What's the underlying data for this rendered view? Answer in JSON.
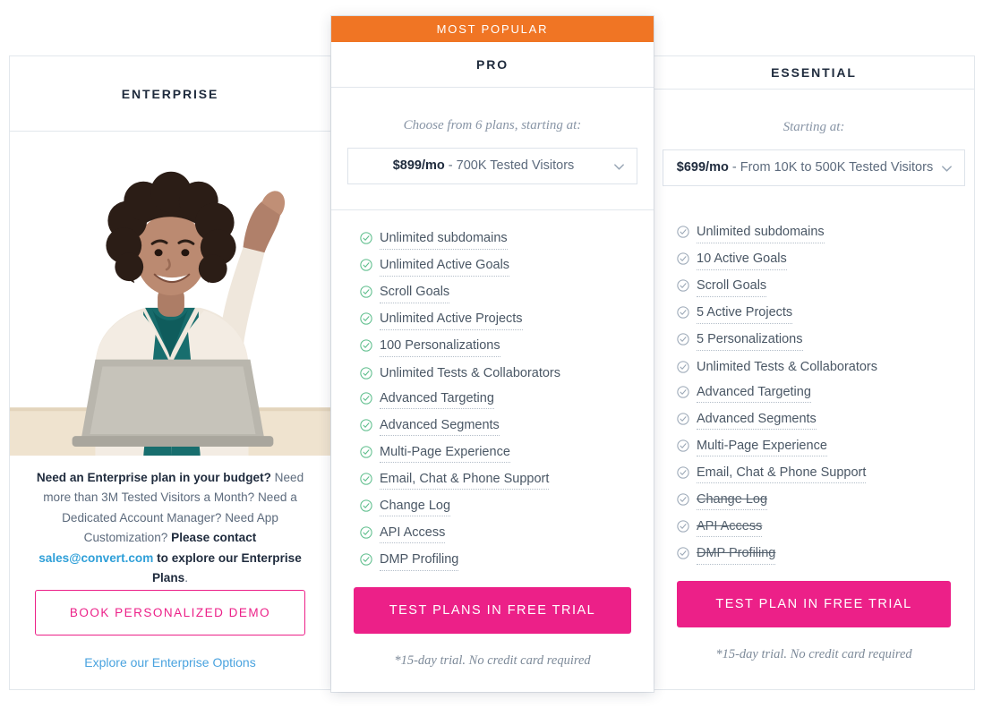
{
  "colors": {
    "accent_orange": "#f07524",
    "accent_pink": "#ec2088",
    "check_green": "#5bbd8a",
    "check_grey": "#9aa7b6",
    "link_blue": "#2e9fd8",
    "heading": "#1f2b3d",
    "border": "#e2e7ec"
  },
  "enterprise": {
    "plan_name": "ENTERPRISE",
    "photo_alt": "smiling-businesswoman-with-laptop-pointing-up",
    "copy": {
      "lead_bold": "Need an Enterprise plan in your budget?",
      "body_1": " Need more than 3M Tested Visitors a Month? Need a Dedicated Account Manager? Need App Customization? ",
      "contact_bold": "Please contact ",
      "email": "sales@convert.com",
      "tail_bold": " to explore our Enterprise Plans",
      "period": "."
    },
    "cta_label": "BOOK PERSONALIZED DEMO",
    "secondary_link": "Explore our Enterprise Options"
  },
  "pro": {
    "badge": "MOST POPULAR",
    "plan_name": "PRO",
    "starting_at": "Choose from 6 plans, starting at:",
    "select": {
      "price": "$899/mo",
      "separator": " - ",
      "detail": "700K Tested Visitors",
      "icon": "chevron-down-icon"
    },
    "features": [
      {
        "label": "Unlimited subdomains",
        "hinted": true,
        "excluded": false
      },
      {
        "label": "Unlimited Active Goals",
        "hinted": true,
        "excluded": false
      },
      {
        "label": "Scroll Goals",
        "hinted": true,
        "excluded": false
      },
      {
        "label": "Unlimited Active Projects",
        "hinted": true,
        "excluded": false
      },
      {
        "label": "100 Personalizations",
        "hinted": true,
        "excluded": false
      },
      {
        "label": "Unlimited Tests & Collaborators",
        "hinted": false,
        "excluded": false
      },
      {
        "label": "Advanced Targeting",
        "hinted": true,
        "excluded": false
      },
      {
        "label": "Advanced Segments",
        "hinted": true,
        "excluded": false
      },
      {
        "label": "Multi-Page Experience",
        "hinted": true,
        "excluded": false
      },
      {
        "label": "Email, Chat & Phone Support",
        "hinted": true,
        "excluded": false
      },
      {
        "label": "Change Log",
        "hinted": true,
        "excluded": false
      },
      {
        "label": "API Access",
        "hinted": true,
        "excluded": false
      },
      {
        "label": "DMP Profiling",
        "hinted": true,
        "excluded": false
      }
    ],
    "cta_label": "TEST PLANS IN FREE TRIAL",
    "trial_note": "*15-day trial. No credit card required"
  },
  "essential": {
    "plan_name": "ESSENTIAL",
    "starting_at": "Starting at:",
    "select": {
      "price": "$699/mo",
      "separator": " - ",
      "detail": "From 10K to 500K Tested Visitors",
      "icon": "chevron-down-icon"
    },
    "features": [
      {
        "label": "Unlimited subdomains",
        "hinted": true,
        "excluded": false
      },
      {
        "label": "10 Active Goals",
        "hinted": true,
        "excluded": false
      },
      {
        "label": "Scroll Goals",
        "hinted": true,
        "excluded": false
      },
      {
        "label": "5 Active Projects",
        "hinted": true,
        "excluded": false
      },
      {
        "label": "5 Personalizations",
        "hinted": true,
        "excluded": false
      },
      {
        "label": "Unlimited Tests & Collaborators",
        "hinted": false,
        "excluded": false
      },
      {
        "label": "Advanced Targeting",
        "hinted": true,
        "excluded": false
      },
      {
        "label": "Advanced Segments",
        "hinted": true,
        "excluded": false
      },
      {
        "label": "Multi-Page Experience",
        "hinted": true,
        "excluded": false
      },
      {
        "label": "Email, Chat & Phone Support",
        "hinted": true,
        "excluded": false
      },
      {
        "label": "Change Log",
        "hinted": true,
        "excluded": true
      },
      {
        "label": "API Access",
        "hinted": true,
        "excluded": true
      },
      {
        "label": "DMP Profiling",
        "hinted": true,
        "excluded": true
      }
    ],
    "cta_label": "TEST PLAN IN FREE TRIAL",
    "trial_note": "*15-day trial. No credit card required"
  }
}
